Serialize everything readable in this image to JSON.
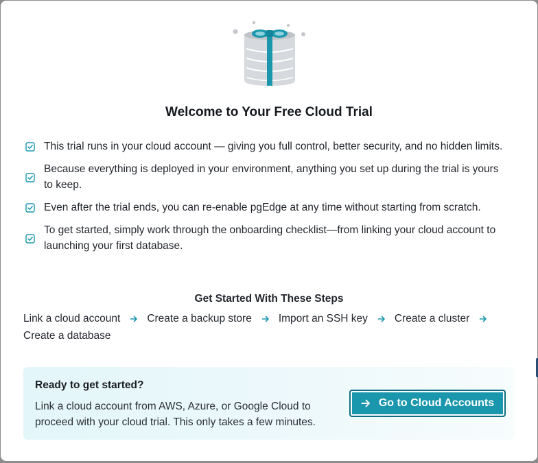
{
  "modal": {
    "title": "Welcome to Your Free Cloud Trial",
    "bullets": [
      "This trial runs in your cloud account — giving you full control, better security, and no hidden limits.",
      "Because everything is deployed in your environment, anything you set up during the trial is yours to keep.",
      "Even after the trial ends, you can re-enable pgEdge at any time without starting from scratch.",
      "To get started, simply work through the onboarding checklist—from linking your cloud account to launching your first database."
    ],
    "steps_title": "Get Started With These Steps",
    "steps": [
      "Link a cloud account",
      "Create a backup store",
      "Import an SSH key",
      "Create a cluster",
      "Create a database"
    ],
    "cta": {
      "title": "Ready to get started?",
      "text": "Link a cloud account from AWS, Azure, or Google Cloud to proceed with your cloud trial. This only takes a few minutes.",
      "button_label": "Go to Cloud Accounts"
    }
  },
  "icons": {
    "illustration": "gift-database-icon",
    "bullet": "check-square-icon",
    "step_separator": "arrow-right-icon",
    "button": "arrow-right-icon"
  },
  "colors": {
    "accent": "#1a97ad",
    "accent_dark": "#0f6f80",
    "cta_background": "#e3f6fa",
    "illustration_gray": "#cdd1d6"
  }
}
